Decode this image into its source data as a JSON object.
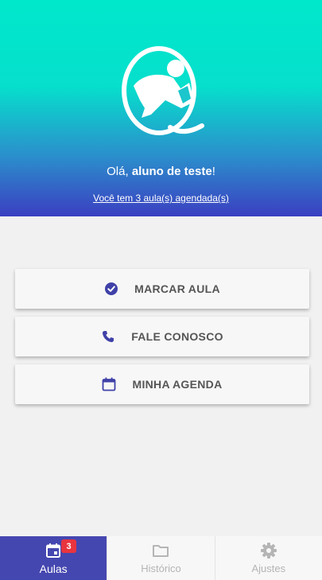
{
  "header": {
    "greeting_prefix": "Olá, ",
    "user_name": "aluno de teste",
    "greeting_suffix": "!",
    "scheduled_link": "Você tem 3 aula(s) agendada(s)"
  },
  "menu": {
    "items": [
      {
        "label": "MARCAR AULA",
        "icon": "check-circle-icon"
      },
      {
        "label": "FALE CONOSCO",
        "icon": "phone-icon"
      },
      {
        "label": "MINHA AGENDA",
        "icon": "calendar-icon"
      }
    ]
  },
  "tabbar": {
    "tabs": [
      {
        "label": "Aulas",
        "icon": "calendar-icon",
        "badge": "3",
        "active": true
      },
      {
        "label": "Histórico",
        "icon": "folder-icon"
      },
      {
        "label": "Ajustes",
        "icon": "gear-icon"
      }
    ]
  },
  "colors": {
    "gradient_top": "#00e8cc",
    "gradient_bottom": "#3b3fc1",
    "accent": "#4547b0",
    "badge": "#e8343f"
  }
}
